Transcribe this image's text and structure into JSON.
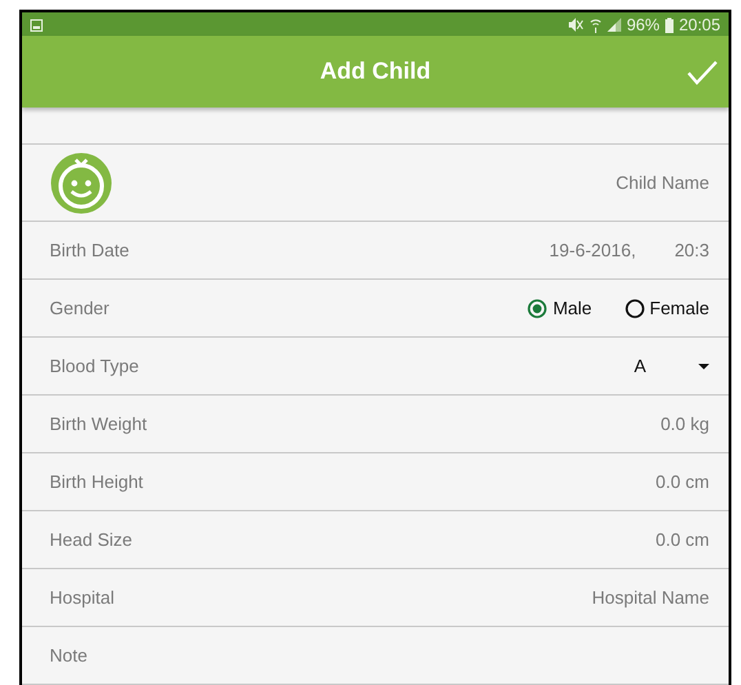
{
  "status_bar": {
    "volume_muted": true,
    "battery": "96%",
    "time": "20:05"
  },
  "toolbar": {
    "title": "Add Child"
  },
  "fields": [
    {
      "kind": "avatar",
      "placeholder": "Child Name"
    },
    {
      "kind": "date",
      "label": "Birth Date",
      "date": "19-6-2016,",
      "time": "20:3"
    },
    {
      "kind": "radio",
      "label": "Gender",
      "options": [
        {
          "label": "Male",
          "selected": true
        },
        {
          "label": "Female",
          "selected": false
        }
      ]
    },
    {
      "kind": "select",
      "label": "Blood Type",
      "value": "A"
    },
    {
      "kind": "text",
      "label": "Birth Weight",
      "placeholder": "0.0 kg"
    },
    {
      "kind": "text",
      "label": "Birth Height",
      "placeholder": "0.0 cm"
    },
    {
      "kind": "text",
      "label": "Head Size",
      "placeholder": "0.0 cm"
    },
    {
      "kind": "text",
      "label": "Hospital",
      "placeholder": "Hospital Name"
    },
    {
      "kind": "text",
      "label": "Note"
    }
  ]
}
